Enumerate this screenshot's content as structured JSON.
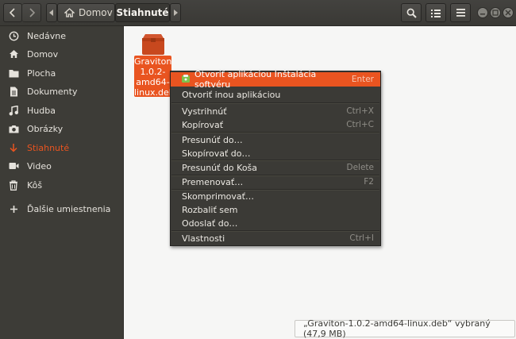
{
  "header": {
    "path_home": "Domov",
    "path_current": "Stiahnuté"
  },
  "sidebar": {
    "items": [
      {
        "label": "Nedávne",
        "icon": "clock-icon"
      },
      {
        "label": "Domov",
        "icon": "home-icon"
      },
      {
        "label": "Plocha",
        "icon": "folder-icon"
      },
      {
        "label": "Dokumenty",
        "icon": "document-icon"
      },
      {
        "label": "Hudba",
        "icon": "music-icon"
      },
      {
        "label": "Obrázky",
        "icon": "camera-icon"
      },
      {
        "label": "Stiahnuté",
        "icon": "download-icon",
        "active": true
      },
      {
        "label": "Video",
        "icon": "video-icon"
      },
      {
        "label": "Kôš",
        "icon": "trash-icon"
      },
      {
        "label": "Ďalšie umiestnenia",
        "icon": "plus-icon"
      }
    ]
  },
  "file": {
    "name": "Graviton-1.0.2-amd64-linux.deb",
    "line1": "Graviton-",
    "line2": "1.0.2-",
    "line3": "amd64-",
    "line4": "linux.deb"
  },
  "context_menu": {
    "items": [
      {
        "label": "Otvoriť aplikáciou Inštalácia softvéru",
        "shortcut": "Enter"
      },
      {
        "label": "Otvoriť inou aplikáciou",
        "shortcut": ""
      },
      {
        "label": "Vystrihnúť",
        "shortcut": "Ctrl+X"
      },
      {
        "label": "Kopírovať",
        "shortcut": "Ctrl+C"
      },
      {
        "label": "Presunúť do…",
        "shortcut": ""
      },
      {
        "label": "Skopírovať do…",
        "shortcut": ""
      },
      {
        "label": "Presunúť do Koša",
        "shortcut": "Delete"
      },
      {
        "label": "Premenovať…",
        "shortcut": "F2"
      },
      {
        "label": "Skomprimovať…",
        "shortcut": ""
      },
      {
        "label": "Rozbaliť sem",
        "shortcut": ""
      },
      {
        "label": "Odoslať do…",
        "shortcut": ""
      },
      {
        "label": "Vlastnosti",
        "shortcut": "Ctrl+I"
      }
    ]
  },
  "status": {
    "text": "„Graviton-1.0.2-amd64-linux.deb“ vybraný  (47,9 MB)"
  },
  "colors": {
    "accent": "#e95420",
    "sidebar_bg": "#3d3c37",
    "menu_bg": "#3b3a36"
  }
}
